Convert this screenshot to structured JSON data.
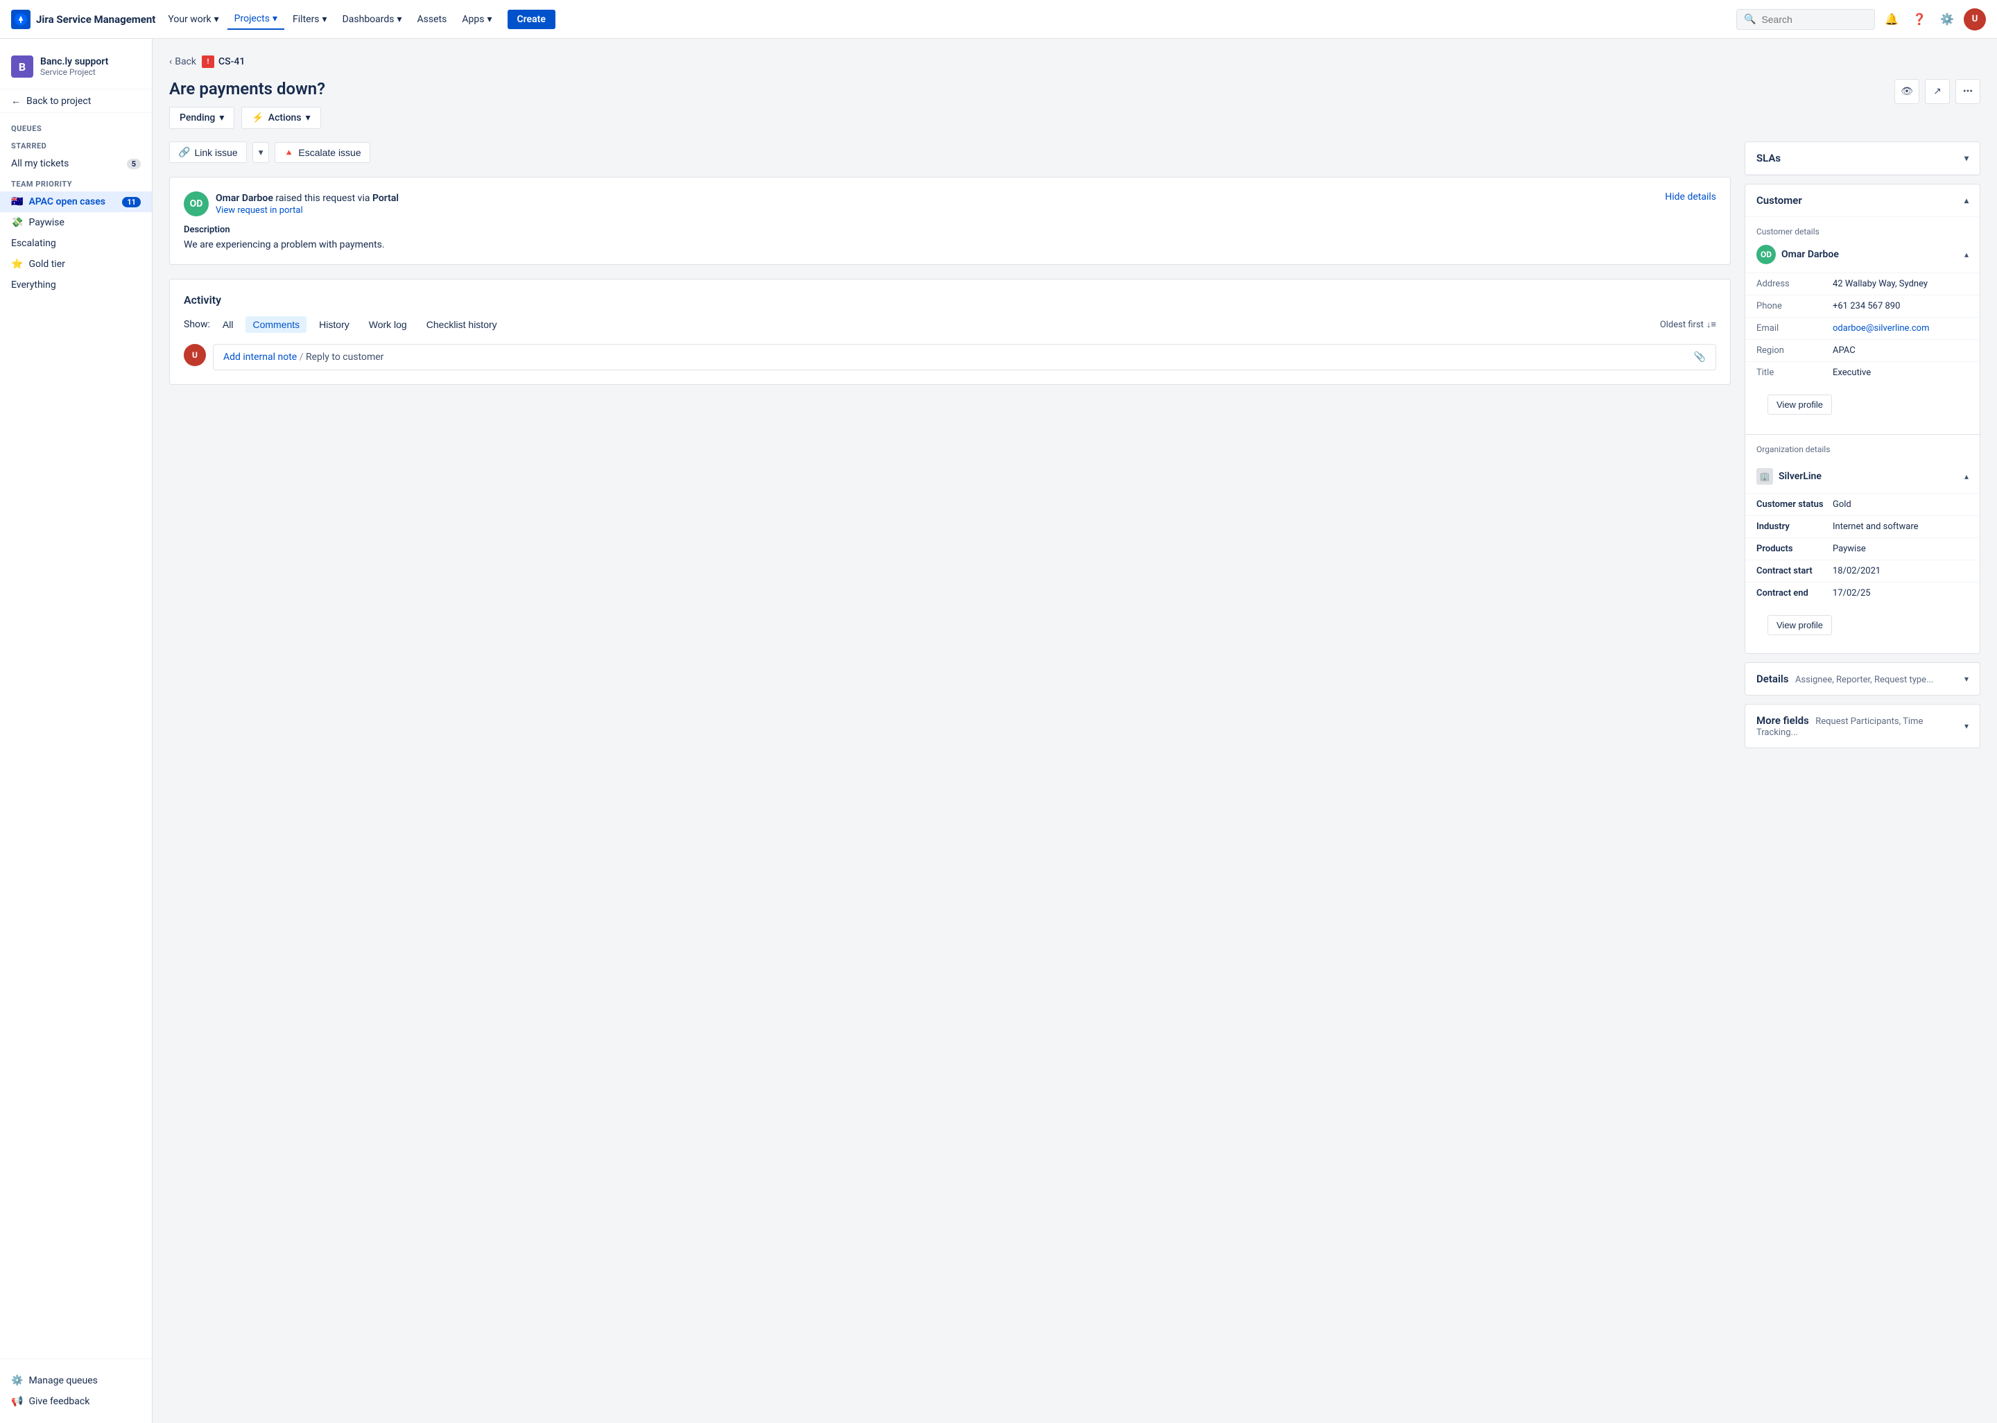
{
  "app": {
    "name": "Jira Service Management"
  },
  "topnav": {
    "logo_text": "Jira Service Management",
    "items": [
      {
        "label": "Your work",
        "dropdown": true,
        "active": false
      },
      {
        "label": "Projects",
        "dropdown": true,
        "active": true
      },
      {
        "label": "Filters",
        "dropdown": true,
        "active": false
      },
      {
        "label": "Dashboards",
        "dropdown": true,
        "active": false
      },
      {
        "label": "Assets",
        "dropdown": false,
        "active": false
      },
      {
        "label": "Apps",
        "dropdown": true,
        "active": false
      }
    ],
    "create_label": "Create",
    "search_placeholder": "Search"
  },
  "sidebar": {
    "project_name": "Banc.ly support",
    "project_type": "Service Project",
    "back_label": "Back to project",
    "queues_label": "Queues",
    "starred_label": "Starred",
    "team_priority_label": "Team Priority",
    "items_starred": [
      {
        "label": "All my tickets",
        "count": 5,
        "active": false
      }
    ],
    "items_team": [
      {
        "label": "APAC open cases",
        "count": 11,
        "active": true,
        "flag": true
      },
      {
        "label": "Paywise",
        "count": null,
        "active": false,
        "emoji": "💸"
      },
      {
        "label": "Escalating",
        "count": null,
        "active": false
      },
      {
        "label": "Gold tier",
        "count": null,
        "active": false,
        "emoji": "⭐"
      },
      {
        "label": "Everything",
        "count": null,
        "active": false
      }
    ],
    "manage_queues": "Manage queues",
    "give_feedback": "Give feedback"
  },
  "breadcrumb": {
    "back": "Back",
    "issue_key": "CS-41"
  },
  "issue": {
    "title": "Are payments down?",
    "status": "Pending",
    "actions_label": "Actions",
    "link_issue_label": "Link issue",
    "escalate_label": "Escalate issue"
  },
  "request": {
    "requester_name": "Omar Darboe",
    "raised_via": "raised this request via",
    "portal_label": "Portal",
    "view_portal": "View request in portal",
    "hide_details": "Hide details",
    "description_label": "Description",
    "description_text": "We are experiencing a problem with payments."
  },
  "activity": {
    "title": "Activity",
    "show_label": "Show:",
    "filters": [
      "All",
      "Comments",
      "History",
      "Work log",
      "Checklist history"
    ],
    "active_filter": "Comments",
    "sort_label": "Oldest first",
    "add_note": "Add internal note",
    "reply_label": "Reply to customer",
    "divider": "/"
  },
  "slas": {
    "label": "SLAs"
  },
  "customer": {
    "label": "Customer",
    "details_label": "Customer details",
    "name": "Omar Darboe",
    "avatar_initials": "OD",
    "fields": [
      {
        "label": "Address",
        "value": "42 Wallaby Way, Sydney",
        "link": false
      },
      {
        "label": "Phone",
        "value": "+61 234 567 890",
        "link": false
      },
      {
        "label": "Email",
        "value": "odarboe@silverline.com",
        "link": true
      },
      {
        "label": "Region",
        "value": "APAC",
        "link": false
      },
      {
        "label": "Title",
        "value": "Executive",
        "link": false
      }
    ],
    "view_profile_label": "View profile",
    "org_label": "Organization details",
    "org_name": "SilverLine",
    "org_fields": [
      {
        "label": "Customer status",
        "value": "Gold",
        "link": false
      },
      {
        "label": "Industry",
        "value": "Internet and software",
        "link": false
      },
      {
        "label": "Products",
        "value": "Paywise",
        "link": false
      },
      {
        "label": "Contract start",
        "value": "18/02/2021",
        "link": false
      },
      {
        "label": "Contract end",
        "value": "17/02/25",
        "link": false
      }
    ],
    "org_view_profile_label": "View profile"
  },
  "details": {
    "label": "Details",
    "sublabel": "Assignee, Reporter, Request type..."
  },
  "more_fields": {
    "label": "More fields",
    "sublabel": "Request Participants, Time Tracking..."
  }
}
